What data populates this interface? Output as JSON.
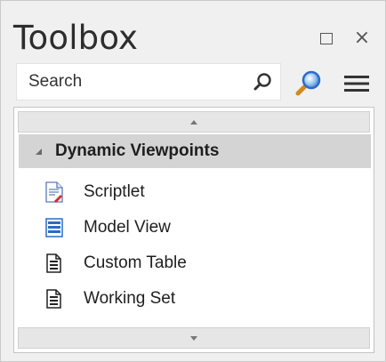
{
  "window": {
    "title": "Toolbox"
  },
  "search": {
    "placeholder": "Search"
  },
  "group": {
    "label": "Dynamic Viewpoints",
    "expanded": true
  },
  "items": [
    {
      "label": "Scriptlet",
      "icon": "scriptlet-icon"
    },
    {
      "label": "Model View",
      "icon": "model-view-icon"
    },
    {
      "label": "Custom Table",
      "icon": "custom-table-icon"
    },
    {
      "label": "Working Set",
      "icon": "working-set-icon"
    }
  ],
  "colors": {
    "accent_blue": "#2b6cc4",
    "header_gray": "#d4d4d4",
    "scriptlet_red": "#d12b2b"
  }
}
